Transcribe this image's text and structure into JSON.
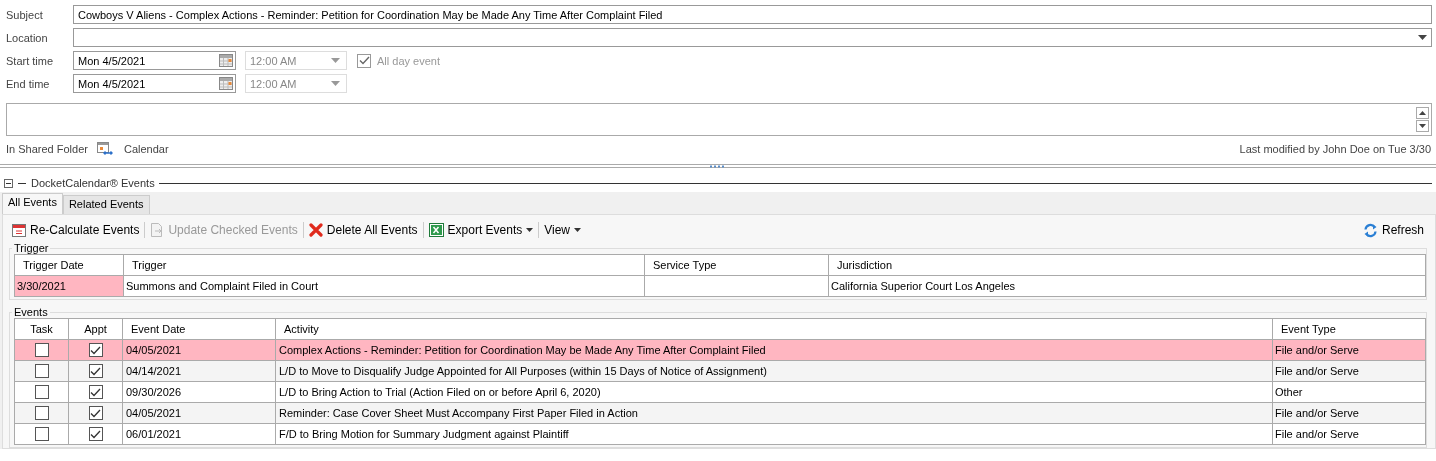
{
  "form": {
    "subject": {
      "label": "Subject",
      "value": "Cowboys V Aliens - Complex Actions - Reminder: Petition for Coordination May be Made Any Time After Complaint Filed"
    },
    "location": {
      "label": "Location"
    },
    "start": {
      "label": "Start time",
      "date": "Mon 4/5/2021",
      "time": "12:00 AM",
      "time_disabled": true
    },
    "end": {
      "label": "End time",
      "date": "Mon 4/5/2021",
      "time": "12:00 AM",
      "time_disabled": true
    },
    "all_day": {
      "label": "All day event",
      "checked": true,
      "disabled": true
    },
    "shared_folder_label": "In Shared Folder",
    "folder": "Calendar",
    "last_modified": "Last modified by John Doe on Tue 3/30"
  },
  "section": {
    "title": "DocketCalendar® Events",
    "expanded": true
  },
  "tabs": [
    {
      "label": "All Events",
      "selected": true
    },
    {
      "label": "Related Events",
      "selected": false
    }
  ],
  "toolbar": [
    {
      "kind": "calendar",
      "label": "Re-Calculate Events",
      "disabled": false,
      "dropdown": false
    },
    {
      "kind": "update",
      "label": "Update Checked Events",
      "disabled": true,
      "dropdown": false
    },
    {
      "kind": "delete",
      "label": "Delete All Events",
      "disabled": false,
      "dropdown": false
    },
    {
      "kind": "excel",
      "label": "Export Events",
      "disabled": false,
      "dropdown": true
    },
    {
      "kind": "none",
      "label": "View",
      "disabled": false,
      "dropdown": true
    }
  ],
  "refresh": "Refresh",
  "trigger": {
    "title": "Trigger",
    "columns": [
      "Trigger Date",
      "Trigger",
      "Service Type",
      "Jurisdiction"
    ],
    "rows": [
      {
        "date": "3/30/2021",
        "trigger": "Summons and Complaint Filed in Court",
        "service_type": "",
        "jurisdiction": "California Superior Court Los Angeles",
        "highlighted": true
      }
    ]
  },
  "events": {
    "title": "Events",
    "columns": [
      "Task",
      "Appt",
      "Event Date",
      "Activity",
      "Event Type"
    ],
    "rows": [
      {
        "task": false,
        "appt": true,
        "date": "04/05/2021",
        "activity": "Complex Actions - Reminder: Petition for Coordination May be Made Any Time After Complaint Filed",
        "type": "File and/or Serve",
        "selected": true
      },
      {
        "task": false,
        "appt": true,
        "date": "04/14/2021",
        "activity": "L/D to Move to Disqualify Judge Appointed for All Purposes (within 15 Days of Notice of Assignment)",
        "type": "File and/or Serve",
        "selected": false
      },
      {
        "task": false,
        "appt": true,
        "date": "09/30/2026",
        "activity": "L/D to Bring Action to Trial (Action Filed on or before April 6, 2020)",
        "type": "Other",
        "selected": false
      },
      {
        "task": false,
        "appt": true,
        "date": "04/05/2021",
        "activity": "Reminder: Case Cover Sheet Must Accompany First Paper Filed in Action",
        "type": "File and/or Serve",
        "selected": false
      },
      {
        "task": false,
        "appt": true,
        "date": "06/01/2021",
        "activity": "F/D to Bring Motion for Summary Judgment against Plaintiff",
        "type": "File and/or Serve",
        "selected": false
      }
    ]
  }
}
